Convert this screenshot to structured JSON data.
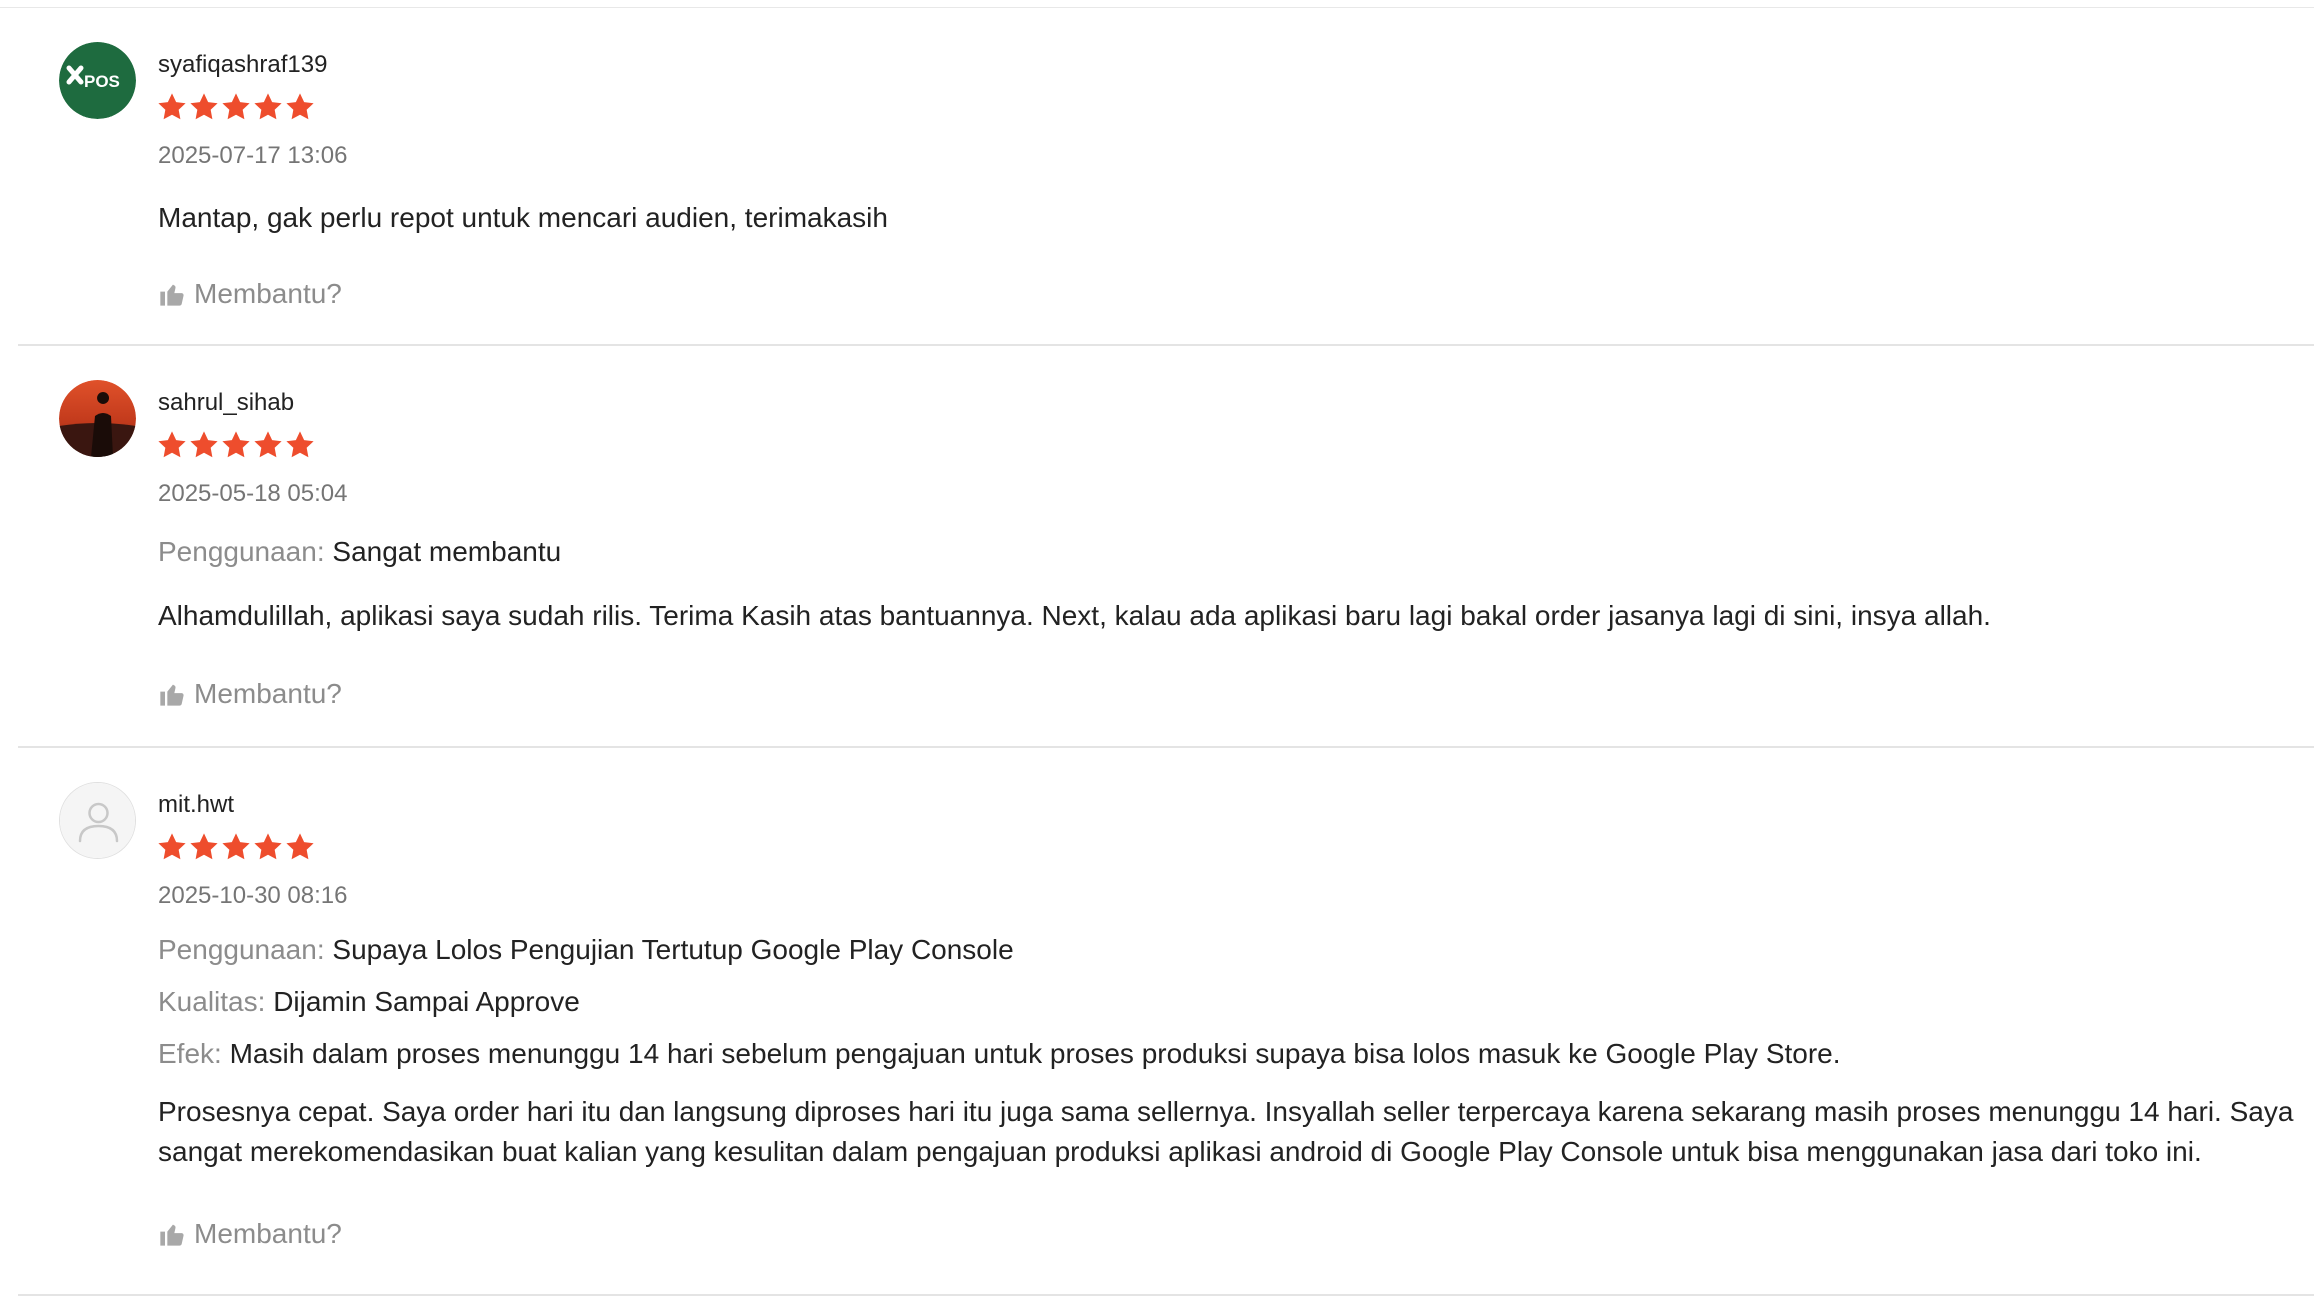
{
  "reviews": [
    {
      "username": "syafiqashraf139",
      "rating": 5,
      "date": "2025-07-17 13:06",
      "avatar_text": "POS",
      "attributes": [],
      "comment": "Mantap, gak perlu repot untuk mencari audien, terimakasih",
      "helpful_label": "Membantu?"
    },
    {
      "username": "sahrul_sihab",
      "rating": 5,
      "date": "2025-05-18 05:04",
      "attributes": [
        {
          "label": "Penggunaan:",
          "value": "Sangat membantu"
        }
      ],
      "comment": "Alhamdulillah, aplikasi saya sudah rilis. Terima Kasih atas bantuannya. Next, kalau ada aplikasi baru lagi bakal order jasanya lagi di sini, insya allah.",
      "helpful_label": "Membantu?"
    },
    {
      "username": "mit.hwt",
      "rating": 5,
      "date": "2025-10-30 08:16",
      "attributes": [
        {
          "label": "Penggunaan:",
          "value": "Supaya Lolos Pengujian Tertutup Google Play Console"
        },
        {
          "label": "Kualitas:",
          "value": "Dijamin Sampai Approve"
        },
        {
          "label": "Efek:",
          "value": "Masih dalam proses menunggu 14 hari sebelum pengajuan untuk proses produksi supaya bisa lolos masuk ke Google Play Store."
        }
      ],
      "comment": "Prosesnya cepat. Saya order hari itu dan langsung diproses hari itu juga sama sellernya. Insyallah seller terpercaya karena sekarang masih proses menunggu 14 hari. Saya sangat merekomendasikan buat kalian yang kesulitan dalam pengajuan produksi aplikasi android di Google Play Console untuk bisa menggunakan jasa dari toko ini.",
      "helpful_label": "Membantu?"
    }
  ],
  "colors": {
    "star": "#ee4d2d",
    "muted_text": "#8c8c8c",
    "date_text": "#757575",
    "divider": "#e4e4e4",
    "avatar1_bg": "#1e6b3f"
  },
  "icons": {
    "helpful": "thumbs-up-icon",
    "more": "more-vertical-icon",
    "default_avatar": "user-icon"
  }
}
